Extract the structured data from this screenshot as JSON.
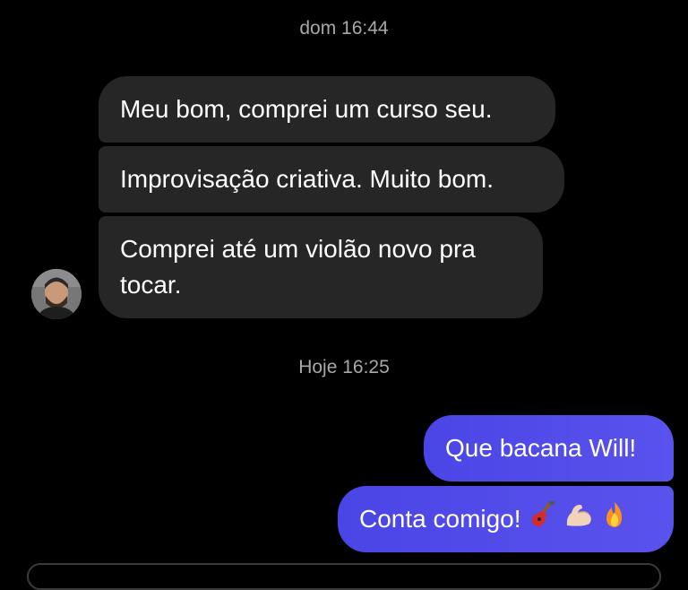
{
  "conversation": {
    "timestamp_1": "dom 16:44",
    "timestamp_2": "Hoje 16:25",
    "incoming": [
      "Meu bom, comprei um curso seu.",
      "Improvisação criativa. Muito bom.",
      "Comprei até um violão novo pra tocar."
    ],
    "outgoing": [
      "Que bacana Will!",
      "Conta comigo!"
    ],
    "outgoing_2_emojis": [
      "guitar-icon",
      "flexed-biceps-icon",
      "fire-icon"
    ]
  },
  "colors": {
    "background": "#000000",
    "incoming_bubble": "#262626",
    "outgoing_bubble": "#4a45e6",
    "timestamp_text": "#a8a8a8"
  }
}
